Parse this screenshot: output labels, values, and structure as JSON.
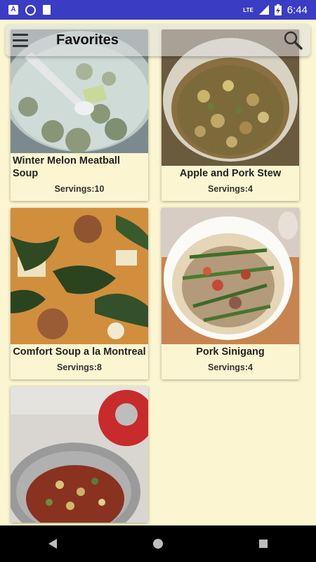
{
  "status_bar": {
    "time": "6:44",
    "network": "LTE",
    "icons": [
      "app-a-icon",
      "sync-circle-icon",
      "sd-card-icon",
      "signal-icon",
      "battery-charging-icon"
    ]
  },
  "app_bar": {
    "title": "Favorites",
    "menu_icon": "hamburger-menu-icon",
    "search_icon": "search-icon"
  },
  "recipes": [
    {
      "title": "Winter Melon Meatball Soup",
      "servings": "Servings:10"
    },
    {
      "title": "Apple and Pork Stew",
      "servings": "Servings:4"
    },
    {
      "title": "Comfort Soup a la Montreal",
      "servings": "Servings:8"
    },
    {
      "title": "Pork Sinigang",
      "servings": "Servings:4"
    },
    {
      "title": "",
      "servings": ""
    }
  ],
  "nav_bar": {
    "back_icon": "back-triangle-icon",
    "home_icon": "home-circle-icon",
    "recents_icon": "recents-square-icon"
  }
}
